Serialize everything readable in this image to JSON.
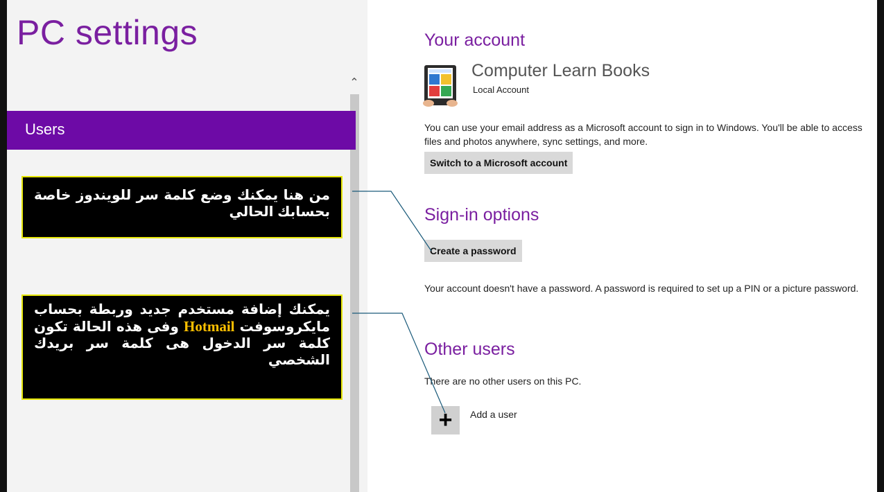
{
  "left": {
    "title": "PC settings",
    "nav": [
      {
        "label": "Users",
        "selected": true
      }
    ],
    "scroll_up_icon": "chevron-up-icon"
  },
  "callouts": {
    "password_note": "من هنا يمكنك وضع كلمة سر للويندوز خاصة بحسابك الحالي",
    "add_user_note_part1": "يمكنك إضافة مستخدم جديد وربطة بحساب مايكروسوفت",
    "add_user_note_hotmail": "Hotmail",
    "add_user_note_part2": "وفى هذه الحالة تكون كلمة سر الدخول هى كلمة سر بريدك الشخصي"
  },
  "account": {
    "heading": "Your account",
    "name": "Computer Learn Books",
    "type": "Local Account",
    "description": "You can use your email address as a Microsoft account to sign in to Windows. You'll be able to access files and photos anywhere, sync settings, and more.",
    "switch_button": "Switch to a Microsoft account"
  },
  "signin": {
    "heading": "Sign-in options",
    "create_password_button": "Create a password",
    "note": "Your account doesn't have a password. A password is required to set up a PIN or a picture password."
  },
  "other_users": {
    "heading": "Other users",
    "empty_text": "There are no other users on this PC.",
    "add_user_label": "Add a user",
    "add_icon": "plus-icon"
  },
  "colors": {
    "accent": "#6d0aa6",
    "heading": "#7a1fa0",
    "callout_bg": "#000000",
    "callout_border": "#e6e600",
    "hotmail": "#ffc000"
  }
}
